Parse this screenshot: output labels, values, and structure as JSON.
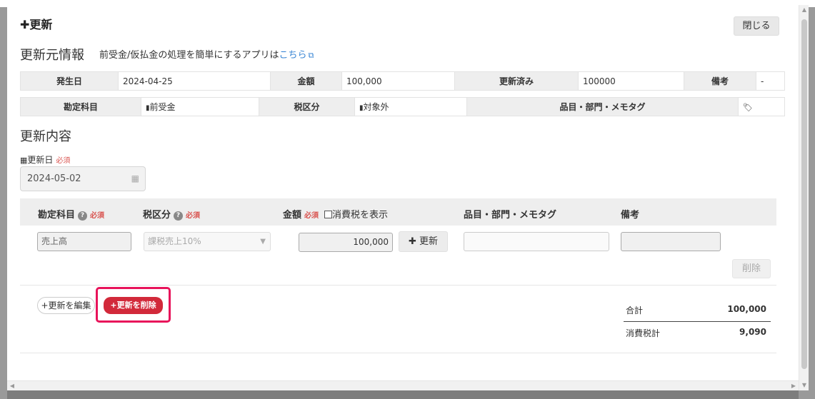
{
  "modal": {
    "title": "更新",
    "close_label": "閉じる"
  },
  "source_section": {
    "heading": "更新元情報",
    "subtitle_text": "前受金/仮払金の処理を簡単にするアプリは",
    "subtitle_link": "こちら",
    "row1": {
      "date_label": "発生日",
      "date_value": "2024-04-25",
      "amount_label": "金額",
      "amount_value": "100,000",
      "updated_label": "更新済み",
      "updated_value": "100000",
      "remarks_label": "備考",
      "remarks_value": "-"
    },
    "row2": {
      "account_label": "勘定科目",
      "account_value": "前受金",
      "tax_label": "税区分",
      "tax_value": "対象外",
      "items_label": "品目・部門・メモタグ",
      "items_value": ""
    }
  },
  "update_section": {
    "heading": "更新内容",
    "date_label": "更新日",
    "required": "必須",
    "date_value": "2024-05-02",
    "columns": {
      "account": "勘定科目",
      "tax": "税区分",
      "amount": "金額",
      "show_tax": "消費税を表示",
      "items": "品目・部門・メモタグ",
      "remarks": "備考"
    },
    "row": {
      "account_value": "売上高",
      "tax_value": "課税売上10%",
      "amount_value": "100,000",
      "update_button": "更新",
      "items_value": "",
      "remarks_value": ""
    },
    "delete_row_label": "削除",
    "edit_update_label": "+更新を編集",
    "delete_update_label": "+更新を削除",
    "totals": {
      "total_label": "合計",
      "total_value": "100,000",
      "tax_label": "消費税計",
      "tax_value": "9,090"
    }
  }
}
